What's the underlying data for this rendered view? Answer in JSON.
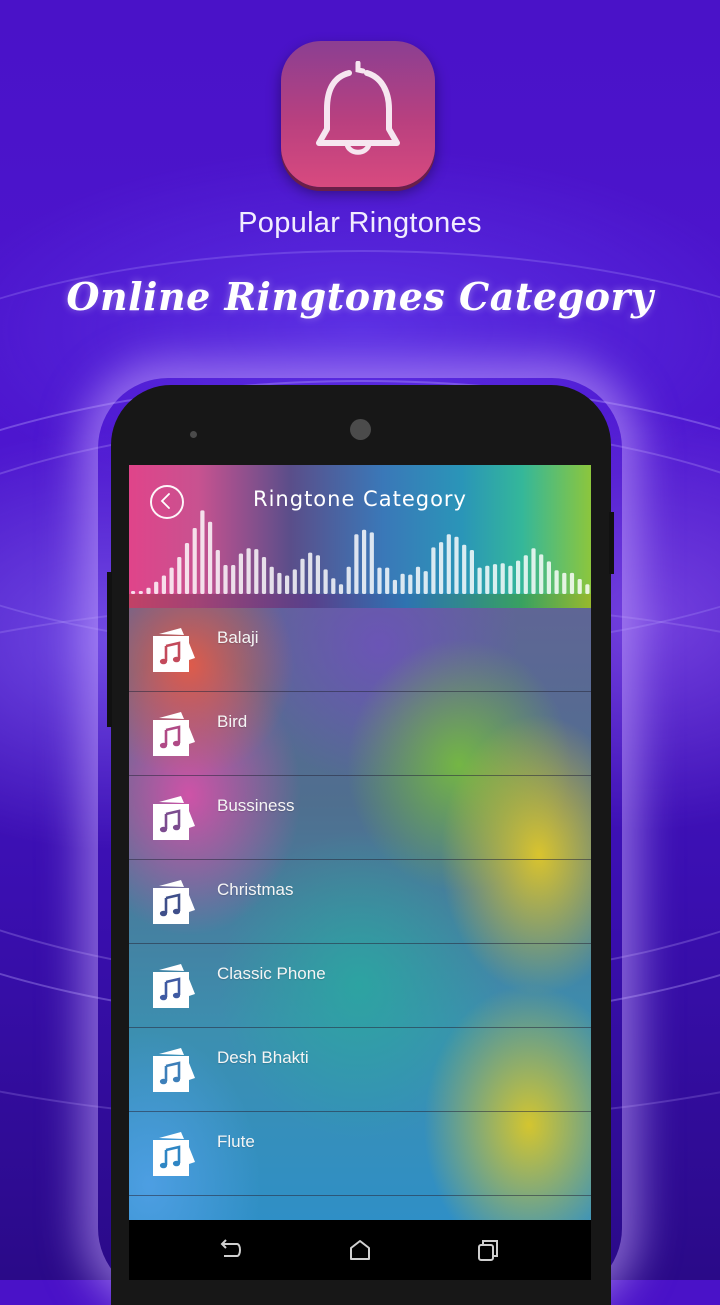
{
  "promo": {
    "app_icon": "bell-icon",
    "subtitle": "Popular Ringtones",
    "headline": "Online Ringtones Category"
  },
  "screen": {
    "header": {
      "back_icon": "chevron-left-circle-icon",
      "title": "Ringtone  Category",
      "equalizer_levels": [
        0.03,
        0.03,
        0.07,
        0.14,
        0.21,
        0.3,
        0.42,
        0.58,
        0.75,
        0.95,
        0.82,
        0.5,
        0.33,
        0.33,
        0.46,
        0.52,
        0.51,
        0.42,
        0.31,
        0.24,
        0.21,
        0.28,
        0.4,
        0.47,
        0.44,
        0.28,
        0.18,
        0.11,
        0.31,
        0.68,
        0.73,
        0.7,
        0.3,
        0.3,
        0.16,
        0.23,
        0.22,
        0.31,
        0.26,
        0.53,
        0.59,
        0.68,
        0.65,
        0.56,
        0.5,
        0.3,
        0.32,
        0.34,
        0.35,
        0.32,
        0.38,
        0.44,
        0.52,
        0.45,
        0.37,
        0.27,
        0.24,
        0.24,
        0.17,
        0.11
      ]
    },
    "categories": [
      {
        "label": "Balaji",
        "icon": "music-album-icon"
      },
      {
        "label": "Bird",
        "icon": "music-album-icon"
      },
      {
        "label": "Bussiness",
        "icon": "music-album-icon"
      },
      {
        "label": "Christmas",
        "icon": "music-album-icon"
      },
      {
        "label": "Classic Phone",
        "icon": "music-album-icon"
      },
      {
        "label": "Desh Bhakti",
        "icon": "music-album-icon"
      },
      {
        "label": "Flute",
        "icon": "music-album-icon"
      }
    ],
    "icon_note_colors": [
      "#c34a5b",
      "#b04a86",
      "#7c4c8f",
      "#3f4f8a",
      "#3f5aa2",
      "#3d7fb9",
      "#2f86c4"
    ]
  },
  "navbar": {
    "back": "back-icon",
    "home": "home-icon",
    "recents": "recents-icon"
  }
}
